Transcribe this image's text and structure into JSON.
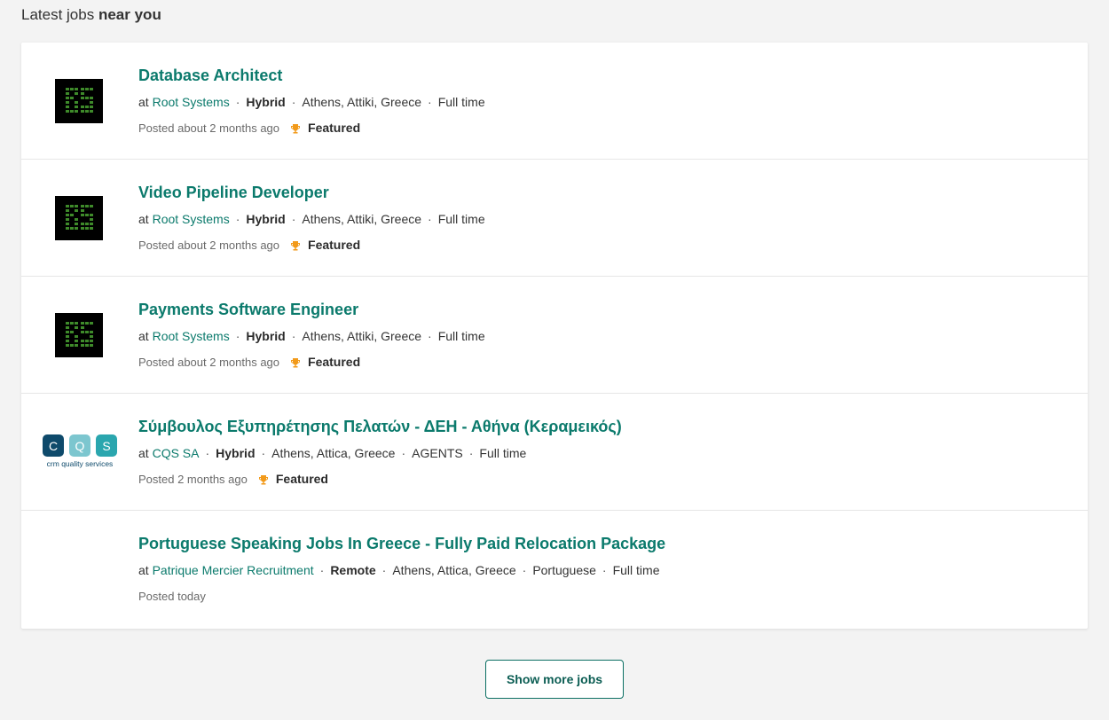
{
  "heading": {
    "prefix": "Latest jobs",
    "emphasis": "near you"
  },
  "jobs": [
    {
      "title": "Database Architect",
      "at": "at",
      "company": "Root Systems",
      "work_mode": "Hybrid",
      "location": "Athens, Attiki, Greece",
      "employment_type": "Full time",
      "posted": "Posted about 2 months ago",
      "featured": "Featured",
      "logo": "root-systems-logo"
    },
    {
      "title": "Video Pipeline Developer",
      "at": "at",
      "company": "Root Systems",
      "work_mode": "Hybrid",
      "location": "Athens, Attiki, Greece",
      "employment_type": "Full time",
      "posted": "Posted about 2 months ago",
      "featured": "Featured",
      "logo": "root-systems-logo"
    },
    {
      "title": "Payments Software Engineer",
      "at": "at",
      "company": "Root Systems",
      "work_mode": "Hybrid",
      "location": "Athens, Attiki, Greece",
      "employment_type": "Full time",
      "posted": "Posted about 2 months ago",
      "featured": "Featured",
      "logo": "root-systems-logo"
    },
    {
      "title": "Σύμβουλος Εξυπηρέτησης Πελατών - ΔΕΗ - Αθήνα (Κεραμεικός)",
      "at": "at",
      "company": "CQS SA",
      "work_mode": "Hybrid",
      "location": "Athens, Attica, Greece",
      "category": "AGENTS",
      "employment_type": "Full time",
      "posted": "Posted 2 months ago",
      "featured": "Featured",
      "logo": "cqs-logo",
      "logo_letters": [
        "C",
        "Q",
        "S"
      ],
      "logo_tagline": "crm quality services"
    },
    {
      "title": "Portuguese Speaking Jobs In Greece - Fully Paid Relocation Package",
      "at": "at",
      "company": "Patrique Mercier Recruitment",
      "work_mode": "Remote",
      "location": "Athens, Attica, Greece",
      "language": "Portuguese",
      "employment_type": "Full time",
      "posted": "Posted today"
    }
  ],
  "dot_separator": "·",
  "show_more_label": "Show more jobs",
  "colors": {
    "accent": "#0b7a6c",
    "trophy": "#f29a1a",
    "background": "#f3f3f3",
    "cqs_dark": "#0e4a6b",
    "cqs_light": "#7cc6cf",
    "cqs_teal": "#2aa6ae"
  },
  "icons": {
    "featured": "trophy-icon"
  }
}
